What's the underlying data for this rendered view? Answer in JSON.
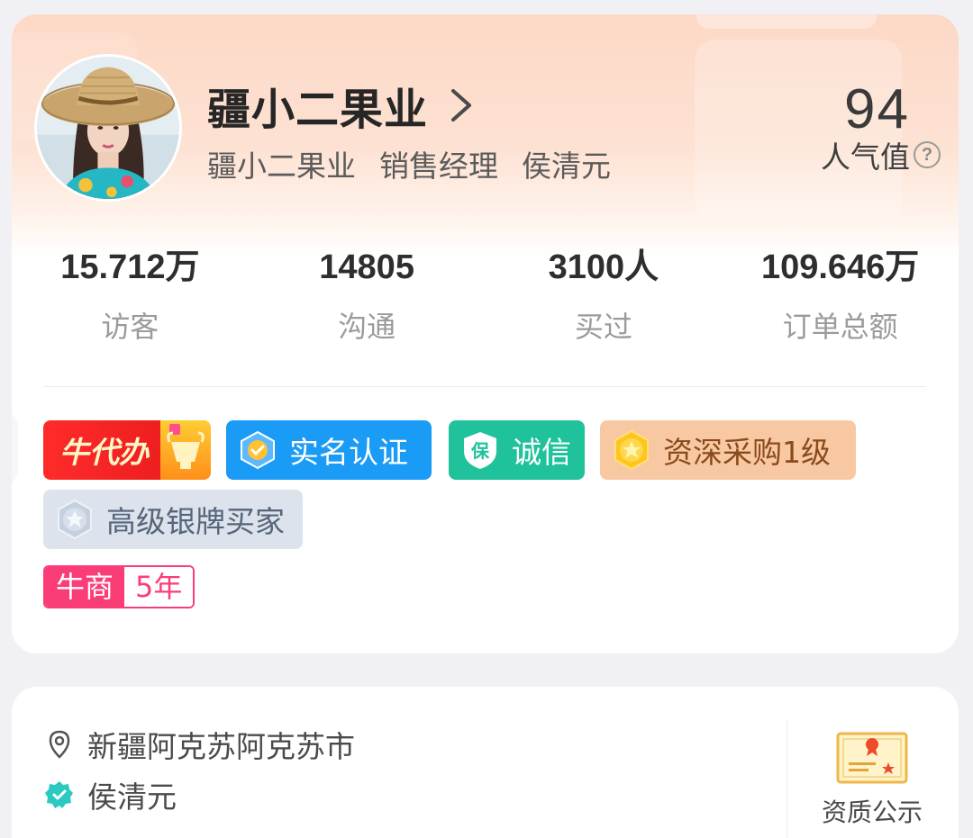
{
  "profile": {
    "shop_name": "疆小二果业",
    "company": "疆小二果业",
    "position": "销售经理",
    "contact_name": "侯清元",
    "popularity_value": "94",
    "popularity_label": "人气值",
    "help_glyph": "?"
  },
  "stats": [
    {
      "value": "15.712万",
      "label": "访客"
    },
    {
      "value": "14805",
      "label": "沟通"
    },
    {
      "value": "3100人",
      "label": "买过"
    },
    {
      "value": "109.646万",
      "label": "订单总额"
    }
  ],
  "badges": {
    "niudaiban": "牛代办",
    "realname": "实名认证",
    "credit": "诚信",
    "credit_icon_text": "保",
    "senior_buyer": "资深采购1级",
    "silver_buyer": "高级银牌买家"
  },
  "niushang": {
    "label": "牛商",
    "years": "5年"
  },
  "info": {
    "location": "新疆阿克苏阿克苏市",
    "verified_name": "侯清元",
    "qualification_label": "资质公示"
  },
  "icons": {
    "chevron": "chevron-right-icon",
    "help": "help-icon",
    "location": "location-pin-icon",
    "verified": "verified-badge-icon",
    "certificate": "certificate-icon"
  },
  "colors": {
    "hero_gradient_top": "#fdd8c6",
    "realname_badge": "#1a9bf5",
    "credit_badge": "#1fc29b",
    "senior_badge": "#f8c8a3",
    "silver_badge": "#dce3ec",
    "niushang": "#fb3d77",
    "niudaiban": "#ee1f1f"
  }
}
